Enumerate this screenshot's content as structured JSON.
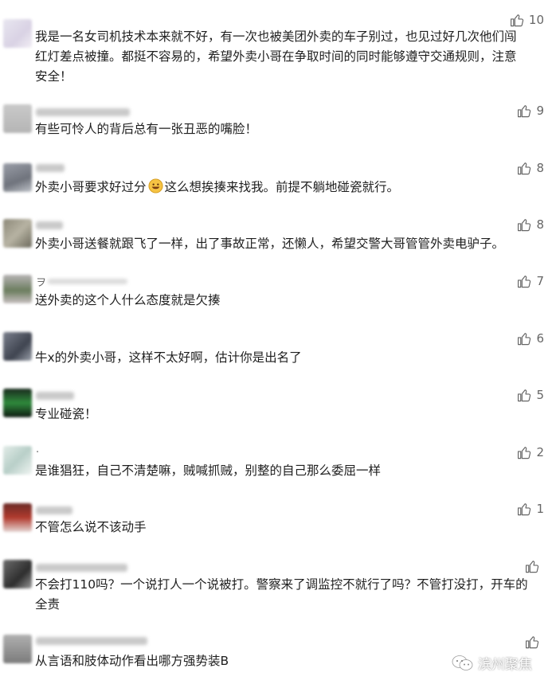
{
  "comments": [
    {
      "nick_char": "",
      "text": "我是一名女司机技术本来就不好，有一次也被美团外卖的车子别过，也见过好几次他们闯红灯差点被撞。都挺不容易的，希望外卖小哥在争取时间的同时能够遵守交通规则，注意安全！",
      "likes": "10"
    },
    {
      "nick_char": "",
      "text": "有些可怜人的背后总有一张丑恶的嘴脸！",
      "likes": "9"
    },
    {
      "nick_char": "",
      "text": "外卖小哥要求好过分",
      "text_after": "这么想挨揍来找我。前提不躺地碰瓷就行。",
      "likes": "8"
    },
    {
      "nick_char": "",
      "text": "外卖小哥送餐就跟飞了一样，出了事故正常，还懒人，希望交警大哥管管外卖电驴子。",
      "likes": "8"
    },
    {
      "nick_char": "ヲ",
      "text": "送外卖的这个人什么态度就是欠揍",
      "likes": "7"
    },
    {
      "nick_char": "",
      "text": "牛x的外卖小哥，这样不太好啊，估计你是出名了",
      "likes": "6"
    },
    {
      "nick_char": "",
      "text": "专业碰瓷！",
      "likes": "5"
    },
    {
      "nick_char": ".",
      "text": "是谁猖狂，自己不清楚嘛，贼喊抓贼，别整的自己那么委屈一样",
      "likes": "2"
    },
    {
      "nick_char": "",
      "text": "不管怎么说不该动手",
      "likes": "1"
    },
    {
      "nick_char": "",
      "text": "不会打110吗？一个说打人一个说被打。警察来了调监控不就行了吗？不管打没打，开车的全责",
      "likes": ""
    },
    {
      "nick_char": "",
      "text": "从言语和肢体动作看出哪方强势装B",
      "likes": ""
    }
  ],
  "watermark": {
    "text": "滨州聚焦"
  },
  "icons": {
    "like": "thumbs-up-icon",
    "emoji": "grinning-emoji-icon",
    "logo": "wechat-logo-icon"
  }
}
